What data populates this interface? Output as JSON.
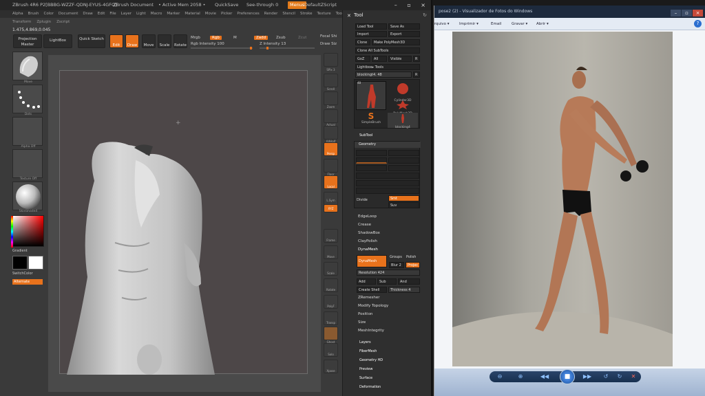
{
  "zbrush": {
    "title_items": [
      "ZBrush 4R6 P2[BBBG-WZZF-QDNJ-EYUS-4GFQ]",
      "ZBrush Document",
      "• Active Mem 2058 •",
      "QuickSave",
      "See-through 0",
      "Menus",
      "DefaultZScript"
    ],
    "window_controls": "– ▫ ×",
    "menus": [
      "Alpha",
      "Brush",
      "Color",
      "Document",
      "Draw",
      "Edit",
      "File",
      "Layer",
      "Light",
      "Macro",
      "Marker",
      "Material",
      "Movie",
      "Picker",
      "Preferences",
      "Render",
      "Stencil",
      "Stroke",
      "Texture",
      "Tool"
    ],
    "submenus": [
      "Transform",
      "Zplugin",
      "Zscript"
    ],
    "coords": "1.475,4.869,0.045",
    "top_buttons": {
      "projection_master": "Projection Master",
      "lightbox": "LightBox",
      "quick_sketch": "Quick Sketch",
      "edit": "Edit",
      "draw": "Draw",
      "move": "Move",
      "scale": "Scale",
      "rotate": "Rotate"
    },
    "top_labels": {
      "mrgb": "Mrgb",
      "rgb": "Rgb",
      "m": "M",
      "zadd": "Zadd",
      "zsub": "Zsub",
      "zcut": "Zcut",
      "rgb_intensity": "Rgb Intensity 100",
      "z_intensity": "Z Intensity 13",
      "focal_shift": "Focal Shi",
      "draw_size": "Draw Siz"
    },
    "left_labels": {
      "brush": "Move",
      "stroke": "Dots",
      "alpha": "Alpha Off",
      "texture": "Texture Off",
      "material": "SkinShade4",
      "gradient": "Gradient",
      "switch_color": "SwitchColor",
      "alternate": "Alternate"
    },
    "right_shelf": [
      "SPix 3",
      "Scroll",
      "Zoom",
      "Actual",
      "AAHalf",
      "Persp",
      "Floor",
      "Local",
      "L.Sym",
      "XYZ",
      "",
      "Frame",
      "Move",
      "Scale",
      "Rotate",
      "PolyF",
      "Transp",
      "Ghost",
      "Solo",
      "Xpose"
    ],
    "tool": {
      "header": "Tool",
      "buttons": {
        "load_tool": "Load Tool",
        "save_as": "Save As",
        "import": "Import",
        "export": "Export",
        "clone": "Clone",
        "make_polymesh": "Make PolyMesh3D",
        "clone_all": "Clone All SubTools",
        "goz": "GoZ",
        "all": "All",
        "visible": "Visible",
        "r": "R",
        "lightbox_tools": "Lightbox▸ Tools",
        "current_tool": "blockingt4. 48",
        "r2": "R"
      },
      "thumbs": {
        "cylinder": "Cylinder3D",
        "polymesh": "PolyMesh3D",
        "simplebrush": "SimpleBrush",
        "blocking": "blocking4",
        "count": "48"
      },
      "subtool": "SubTool",
      "geometry": "Geometry",
      "divide": "Divide",
      "smt": "Smt",
      "suv": "Suv",
      "sections": [
        "EdgeLoop",
        "Crease",
        "ShadowBox",
        "ClayPolish"
      ],
      "dynamesh_header": "DynaMesh",
      "dynamesh_btn": "DynaMesh",
      "groups": "Groups",
      "polish": "Polish",
      "blur": "Blur 2",
      "project": "Projec",
      "resolution": "Resolution 424",
      "add": "Add",
      "sub": "Sub",
      "and": "And",
      "create_shell": "Create Shell",
      "thickness": "Thickness 4",
      "sections2": [
        "ZRemesher",
        "Modify Topology",
        "Position",
        "Size",
        "MeshIntegrity"
      ],
      "sections3": [
        "Layers",
        "FiberMesh",
        "Geometry HD",
        "Preview",
        "Surface",
        "Deformation"
      ]
    }
  },
  "viewer": {
    "title": "pose2 (2) - Visualizador de Fotos do Windows",
    "menus": [
      "Arquivo ▾",
      "Imprimir ▾",
      "Email",
      "Gravar ▾",
      "Abrir ▾"
    ],
    "help": "?",
    "toolbar_icons": [
      "⊖",
      "⊕",
      "◀◀",
      "■",
      "▶▶",
      "↺",
      "↻",
      "✕"
    ]
  }
}
